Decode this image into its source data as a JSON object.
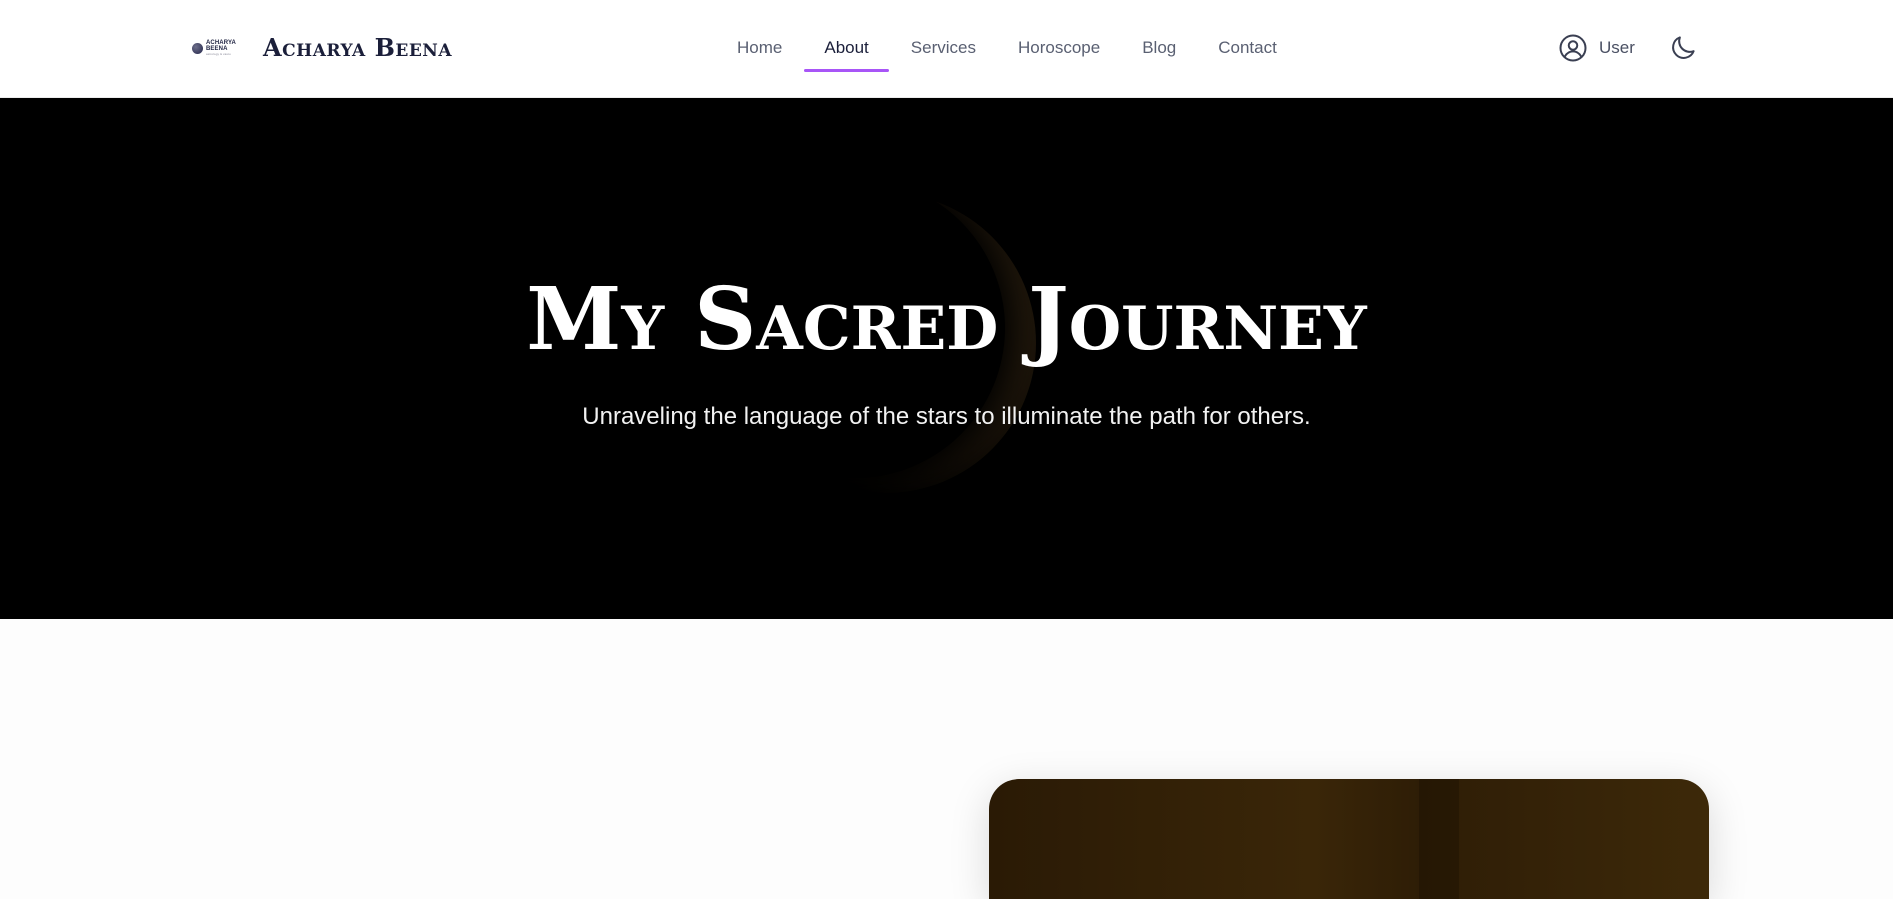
{
  "header": {
    "logo": {
      "line1": "ACHARYA",
      "line2": "BEENA",
      "tagline": "astrology & vastu"
    },
    "brand_name": "Acharya Beena",
    "nav": [
      {
        "label": "Home",
        "active": false
      },
      {
        "label": "About",
        "active": true
      },
      {
        "label": "Services",
        "active": false
      },
      {
        "label": "Horoscope",
        "active": false
      },
      {
        "label": "Blog",
        "active": false
      },
      {
        "label": "Contact",
        "active": false
      }
    ],
    "user_label": "User",
    "icons": {
      "user": "user-circle-icon",
      "theme": "moon-icon"
    },
    "accent_color": "#a855f7"
  },
  "hero": {
    "title": "My Sacred Journey",
    "subtitle": "Unraveling the language of the stars to illuminate the path for others.",
    "background_color": "#000000"
  },
  "content": {
    "photo_card": {
      "image": "portrait-photo"
    }
  }
}
